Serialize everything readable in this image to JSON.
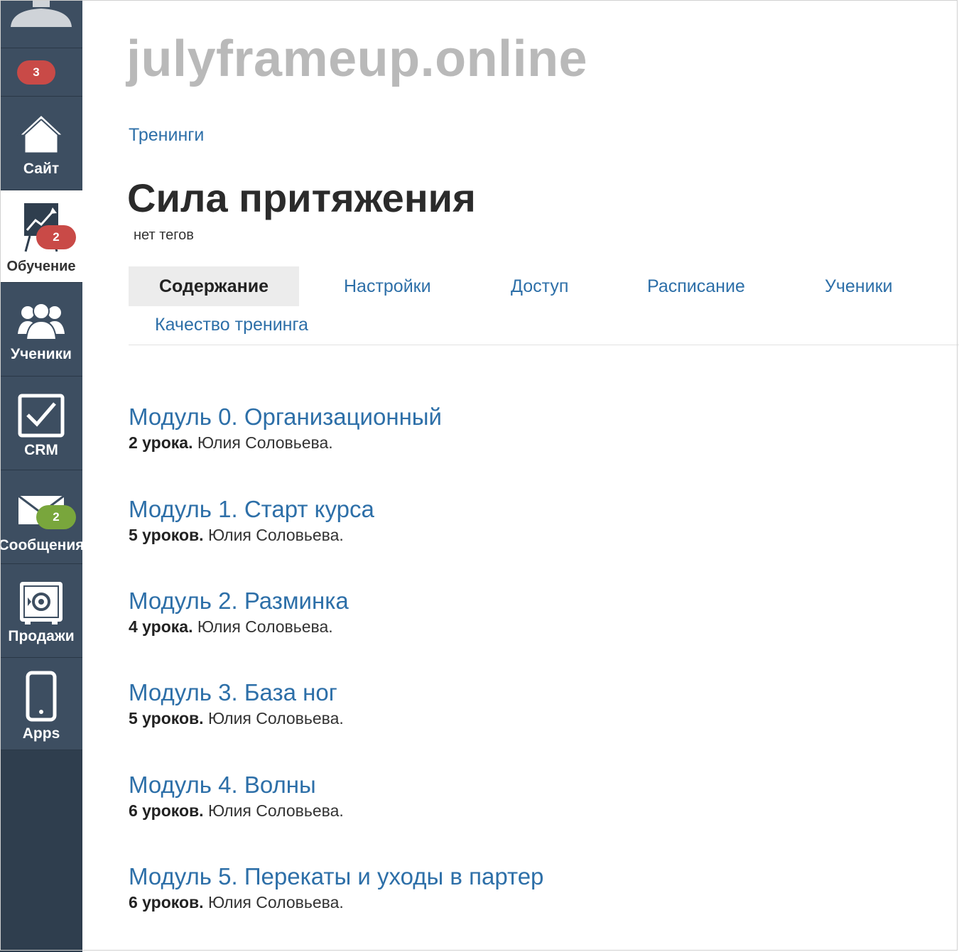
{
  "sidebar": {
    "top_badge": "3",
    "items": [
      {
        "id": "site",
        "label": "Сайт",
        "icon": "house-icon",
        "badge": null
      },
      {
        "id": "training",
        "label": "Обучение",
        "icon": "chart-board-icon",
        "badge": "2",
        "active": true
      },
      {
        "id": "students",
        "label": "Ученики",
        "icon": "users-icon",
        "badge": null
      },
      {
        "id": "crm",
        "label": "CRM",
        "icon": "checkbox-icon",
        "badge": null
      },
      {
        "id": "messages",
        "label": "Сообщения",
        "icon": "envelope-icon",
        "badge": "2"
      },
      {
        "id": "sales",
        "label": "Продажи",
        "icon": "safe-icon",
        "badge": null
      },
      {
        "id": "apps",
        "label": "Apps",
        "icon": "phone-icon",
        "badge": null
      }
    ]
  },
  "header": {
    "site_title": "julyframeup.online",
    "breadcrumb": "Тренинги",
    "page_title": "Сила притяжения",
    "tags": "нет тегов"
  },
  "tabs": [
    {
      "label": "Содержание",
      "active": true
    },
    {
      "label": "Настройки"
    },
    {
      "label": "Доступ"
    },
    {
      "label": "Расписание"
    },
    {
      "label": "Ученики"
    },
    {
      "label": "Качество тренинга"
    }
  ],
  "modules": [
    {
      "title": "Модуль 0. Организационный",
      "lessons": "2 урока.",
      "author": "Юлия Соловьева."
    },
    {
      "title": "Модуль 1. Старт курса",
      "lessons": "5 уроков.",
      "author": "Юлия Соловьева."
    },
    {
      "title": "Модуль 2. Разминка",
      "lessons": "4 урока.",
      "author": "Юлия Соловьева."
    },
    {
      "title": "Модуль 3. База ног",
      "lessons": "5 уроков.",
      "author": "Юлия Соловьева."
    },
    {
      "title": "Модуль 4. Волны",
      "lessons": "6 уроков.",
      "author": "Юлия Соловьева."
    },
    {
      "title": "Модуль 5. Перекаты и уходы в партер",
      "lessons": "6 уроков.",
      "author": "Юлия Соловьева."
    }
  ],
  "colors": {
    "sidebar_bg": "#3d4e61",
    "link_blue": "#2d6fa8",
    "badge_red": "#c94a47",
    "badge_green": "#79a63c"
  }
}
